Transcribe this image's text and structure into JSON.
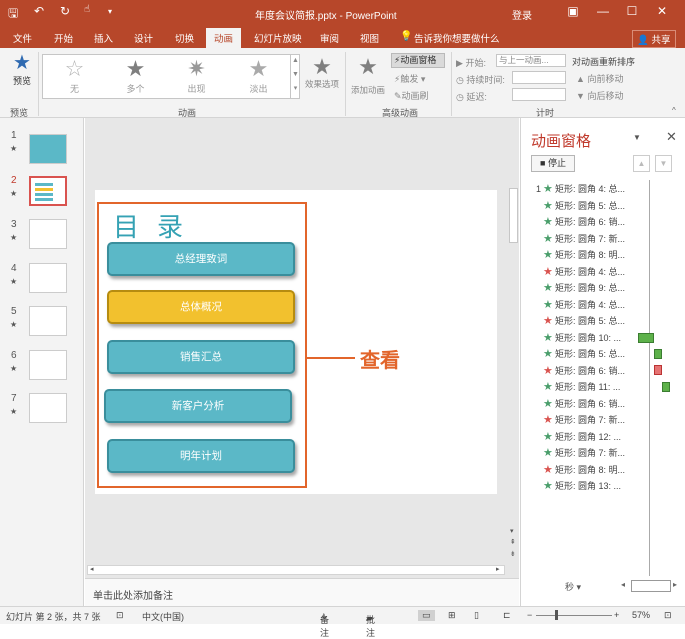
{
  "window": {
    "title": "年度会议简报.pptx - PowerPoint",
    "login": "登录",
    "icons": [
      "save-icon",
      "undo-icon",
      "redo-icon",
      "touch-mode-icon",
      "qat-dropdown-icon"
    ]
  },
  "tabs": [
    {
      "label": "文件",
      "active": false
    },
    {
      "label": "开始",
      "active": false
    },
    {
      "label": "插入",
      "active": false
    },
    {
      "label": "设计",
      "active": false
    },
    {
      "label": "切换",
      "active": false
    },
    {
      "label": "动画",
      "active": true
    },
    {
      "label": "幻灯片放映",
      "active": false
    },
    {
      "label": "审阅",
      "active": false
    },
    {
      "label": "视图",
      "active": false
    }
  ],
  "tell_me": "告诉我你想要做什么",
  "share": "共享",
  "ribbon": {
    "preview": {
      "button": "预览",
      "group": "预览"
    },
    "animation_group": "动画",
    "effects": [
      "无",
      "多个",
      "出现",
      "淡出"
    ],
    "effect_options": "效果选项",
    "advanced_group": "高级动画",
    "add_animation": "添加动画",
    "anim_pane_btn": "动画窗格",
    "trigger": "触发",
    "painter": "动画刷",
    "timing_group": "计时",
    "start_label": "开始:",
    "start_value": "与上一动画...",
    "duration_label": "持续时间:",
    "delay_label": "延迟:",
    "reorder_label": "对动画重新排序",
    "move_earlier": "向前移动",
    "move_later": "向后移动"
  },
  "thumbnails": [
    {
      "num": "1",
      "active": false
    },
    {
      "num": "2",
      "active": true
    },
    {
      "num": "3",
      "active": false
    },
    {
      "num": "4",
      "active": false
    },
    {
      "num": "5",
      "active": false
    },
    {
      "num": "6",
      "active": false
    },
    {
      "num": "7",
      "active": false
    }
  ],
  "slide": {
    "title": "目录",
    "buttons": [
      "总经理致词",
      "总体概况",
      "销售汇总",
      "新客户分析",
      "明年计划"
    ],
    "callout": "查看"
  },
  "notes_placeholder": "单击此处添加备注",
  "anim_pane": {
    "title": "动画窗格",
    "stop": "停止",
    "items": [
      {
        "num": "1",
        "color": "green",
        "text": "矩形: 圆角 4: 总..."
      },
      {
        "num": "",
        "color": "green",
        "text": "矩形: 圆角 5: 总..."
      },
      {
        "num": "",
        "color": "green",
        "text": "矩形: 圆角 6: 销..."
      },
      {
        "num": "",
        "color": "green",
        "text": "矩形: 圆角 7: 新..."
      },
      {
        "num": "",
        "color": "green",
        "text": "矩形: 圆角 8: 明..."
      },
      {
        "num": "",
        "color": "red",
        "text": "矩形: 圆角 4: 总..."
      },
      {
        "num": "",
        "color": "green",
        "text": "矩形: 圆角 9: 总..."
      },
      {
        "num": "",
        "color": "green",
        "text": "矩形: 圆角 4: 总..."
      },
      {
        "num": "",
        "color": "red",
        "text": "矩形: 圆角 5: 总..."
      },
      {
        "num": "",
        "color": "green",
        "text": "矩形: 圆角 10: ..."
      },
      {
        "num": "",
        "color": "green",
        "text": "矩形: 圆角 5: 总..."
      },
      {
        "num": "",
        "color": "red",
        "text": "矩形: 圆角 6: 销..."
      },
      {
        "num": "",
        "color": "green",
        "text": "矩形: 圆角 11: ..."
      },
      {
        "num": "",
        "color": "green",
        "text": "矩形: 圆角 6: 销..."
      },
      {
        "num": "",
        "color": "red",
        "text": "矩形: 圆角 7: 新..."
      },
      {
        "num": "",
        "color": "green",
        "text": "矩形: 圆角 12: ..."
      },
      {
        "num": "",
        "color": "green",
        "text": "矩形: 圆角 7: 新..."
      },
      {
        "num": "",
        "color": "red",
        "text": "矩形: 圆角 8: 明..."
      },
      {
        "num": "",
        "color": "green",
        "text": "矩形: 圆角 13: ..."
      }
    ],
    "seconds_label": "秒"
  },
  "status": {
    "slide_info": "幻灯片 第 2 张，共 7 张",
    "language": "中文(中国)",
    "notes": "备注",
    "comments": "批注",
    "zoom": "57%"
  },
  "colors": {
    "accent": "#b7472a",
    "teal": "#5bb8c7",
    "yellow": "#f2c12e",
    "orange": "#e2652b",
    "star_green": "#4a9e6b",
    "star_red": "#d9534f"
  }
}
